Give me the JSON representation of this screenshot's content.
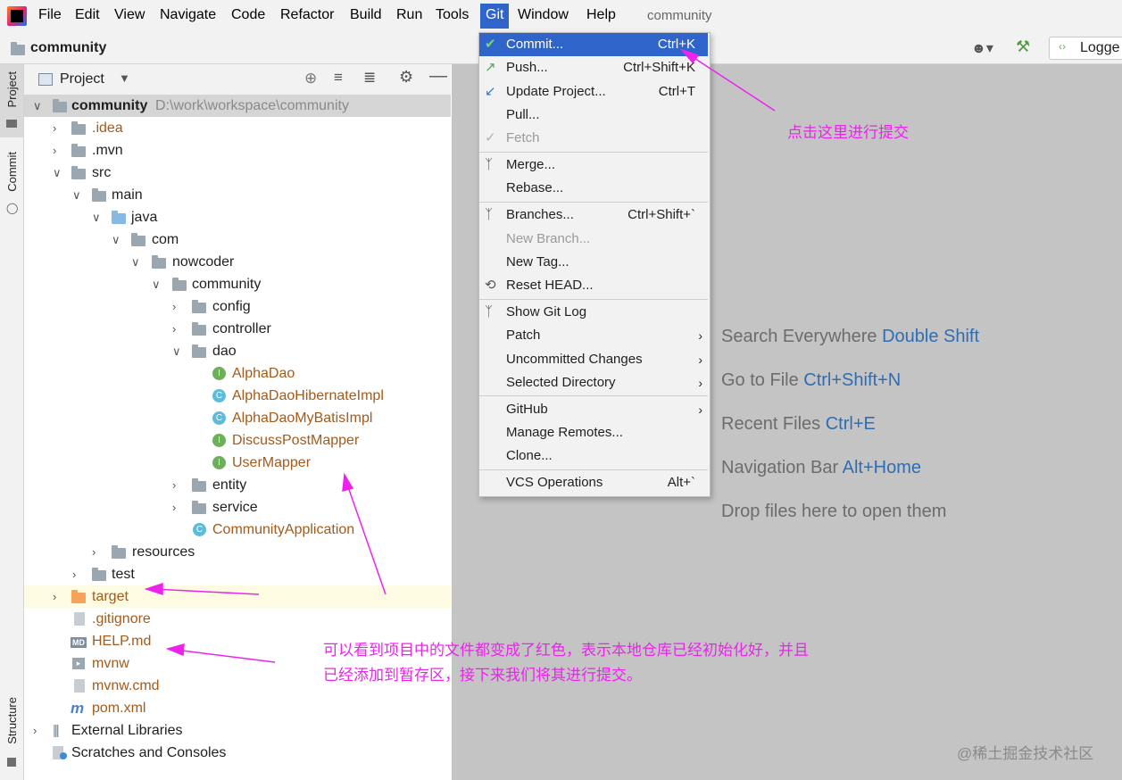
{
  "menubar": {
    "items": [
      "File",
      "Edit",
      "View",
      "Navigate",
      "Code",
      "Refactor",
      "Build",
      "Run",
      "Tools",
      "Git",
      "Window",
      "Help"
    ],
    "project_name": "community"
  },
  "navbar": {
    "crumb": "community",
    "run_config": "Logge"
  },
  "stripe": {
    "project": "Project",
    "commit": "Commit",
    "structure": "Structure"
  },
  "project_panel": {
    "title": "Project",
    "root_name": "community",
    "root_path": "D:\\work\\workspace\\community",
    "rows": [
      {
        "label": ".idea"
      },
      {
        "label": ".mvn"
      },
      {
        "label": "src"
      },
      {
        "label": "main"
      },
      {
        "label": "java"
      },
      {
        "label": "com"
      },
      {
        "label": "nowcoder"
      },
      {
        "label": "community"
      },
      {
        "label": "config"
      },
      {
        "label": "controller"
      },
      {
        "label": "dao"
      },
      {
        "label": "AlphaDao"
      },
      {
        "label": "AlphaDaoHibernateImpl"
      },
      {
        "label": "AlphaDaoMyBatisImpl"
      },
      {
        "label": "DiscussPostMapper"
      },
      {
        "label": "UserMapper"
      },
      {
        "label": "entity"
      },
      {
        "label": "service"
      },
      {
        "label": "CommunityApplication"
      },
      {
        "label": "resources"
      },
      {
        "label": "test"
      },
      {
        "label": "target"
      },
      {
        "label": ".gitignore"
      },
      {
        "label": "HELP.md"
      },
      {
        "label": "mvnw"
      },
      {
        "label": "mvnw.cmd"
      },
      {
        "label": "pom.xml"
      },
      {
        "label": "External Libraries"
      },
      {
        "label": "Scratches and Consoles"
      }
    ]
  },
  "git_menu": {
    "items": [
      {
        "label": "Commit...",
        "shortcut": "Ctrl+K"
      },
      {
        "label": "Push...",
        "shortcut": "Ctrl+Shift+K"
      },
      {
        "label": "Update Project...",
        "shortcut": "Ctrl+T"
      },
      {
        "label": "Pull...",
        "shortcut": ""
      },
      {
        "label": "Fetch",
        "shortcut": ""
      },
      {
        "label": "Merge...",
        "shortcut": ""
      },
      {
        "label": "Rebase...",
        "shortcut": ""
      },
      {
        "label": "Branches...",
        "shortcut": "Ctrl+Shift+`"
      },
      {
        "label": "New Branch...",
        "shortcut": ""
      },
      {
        "label": "New Tag...",
        "shortcut": ""
      },
      {
        "label": "Reset HEAD...",
        "shortcut": ""
      },
      {
        "label": "Show Git Log",
        "shortcut": ""
      },
      {
        "label": "Patch",
        "shortcut": ""
      },
      {
        "label": "Uncommitted Changes",
        "shortcut": ""
      },
      {
        "label": "Selected Directory",
        "shortcut": ""
      },
      {
        "label": "GitHub",
        "shortcut": ""
      },
      {
        "label": "Manage Remotes...",
        "shortcut": ""
      },
      {
        "label": "Clone...",
        "shortcut": ""
      },
      {
        "label": "VCS Operations",
        "shortcut": "Alt+`"
      }
    ]
  },
  "editor_hints": [
    {
      "text": "Search Everywhere",
      "key": "Double Shift"
    },
    {
      "text": "Go to File",
      "key": "Ctrl+Shift+N"
    },
    {
      "text": "Recent Files",
      "key": "Ctrl+E"
    },
    {
      "text": "Navigation Bar",
      "key": "Alt+Home"
    },
    {
      "text": "Drop files here to open them",
      "key": ""
    }
  ],
  "annotations": {
    "commit_note": "点击这里进行提交",
    "files_note_line1": "可以看到项目中的文件都变成了红色，表示本地仓库已经初始化好，并且",
    "files_note_line2": "已经添加到暂存区，接下来我们将其进行提交。",
    "watermark": "@稀土掘金技术社区"
  },
  "colors": {
    "menu_highlight": "#2f65ca",
    "annotation": "#ee22ee",
    "untracked_file": "#a45a1a",
    "shortcut_key": "#2f6db3"
  }
}
